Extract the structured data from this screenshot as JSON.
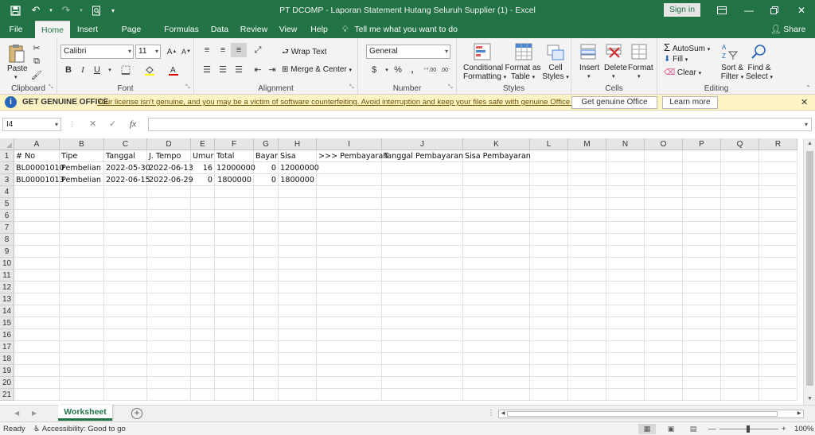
{
  "window": {
    "title": "PT DCOMP - Laporan Statement Hutang Seluruh Supplier (1)  -  Excel",
    "signin": "Sign in"
  },
  "tabs": [
    "File",
    "Home",
    "Insert",
    "Page Layout",
    "Formulas",
    "Data",
    "Review",
    "View",
    "Help"
  ],
  "tell_me": "Tell me what you want to do",
  "share": "Share",
  "ribbon": {
    "clipboard": {
      "label": "Clipboard",
      "paste": "Paste"
    },
    "font": {
      "label": "Font",
      "name": "Calibri",
      "size": "11",
      "bold": "B",
      "italic": "I",
      "underline": "U"
    },
    "alignment": {
      "label": "Alignment",
      "wrap": "Wrap Text",
      "merge": "Merge & Center"
    },
    "number": {
      "label": "Number",
      "format": "General",
      "currency": "$",
      "percent": "%",
      "comma": ","
    },
    "styles": {
      "label": "Styles",
      "conditional": [
        "Conditional",
        "Formatting"
      ],
      "format_table": [
        "Format as",
        "Table"
      ],
      "cell_styles": [
        "Cell",
        "Styles"
      ]
    },
    "cells": {
      "label": "Cells",
      "insert": "Insert",
      "delete": "Delete",
      "format": "Format"
    },
    "editing": {
      "label": "Editing",
      "autosum": "AutoSum",
      "fill": "Fill",
      "clear": "Clear",
      "sort": [
        "Sort &",
        "Filter"
      ],
      "find": [
        "Find &",
        "Select"
      ]
    }
  },
  "message_bar": {
    "heading": "GET GENUINE OFFICE",
    "text": "Your license isn't genuine, and you may be a victim of software counterfeiting. Avoid interruption and keep your files safe with genuine Office today.",
    "primary_button": "Get genuine Office",
    "secondary_button": "Learn more"
  },
  "formula_bar": {
    "name_box": "I4",
    "fx": "fx",
    "value": ""
  },
  "columns": [
    "A",
    "B",
    "C",
    "D",
    "E",
    "F",
    "G",
    "H",
    "I",
    "J",
    "K",
    "L",
    "M",
    "N",
    "O",
    "P",
    "Q",
    "R"
  ],
  "rows": [
    "1",
    "2",
    "3",
    "4",
    "5",
    "6",
    "7",
    "8",
    "9",
    "10",
    "11",
    "12",
    "13",
    "14",
    "15",
    "16",
    "17",
    "18",
    "19",
    "20",
    "21"
  ],
  "cells": [
    [
      "# No",
      "Tipe",
      "Tanggal",
      "J. Tempo",
      "Umur",
      "Total",
      "Bayar",
      "Sisa",
      ">>> Pembayaran",
      "Tanggal Pembayaran",
      "Sisa Pembayaran"
    ],
    [
      "BL00001010",
      "Pembelian",
      "2022-05-30",
      "2022-06-13",
      "16",
      "12000000",
      "0",
      "12000000",
      "",
      "",
      ""
    ],
    [
      "BL00001013",
      "Pembelian",
      "2022-06-15",
      "2022-06-29",
      "0",
      "1800000",
      "0",
      "1800000",
      "",
      "",
      ""
    ]
  ],
  "sheet_tab": "Worksheet",
  "status": {
    "ready": "Ready",
    "accessibility": "Accessibility: Good to go",
    "zoom": "100%"
  },
  "colors": {
    "excel_green": "#217346",
    "message_bar": "#fdf3c5"
  }
}
